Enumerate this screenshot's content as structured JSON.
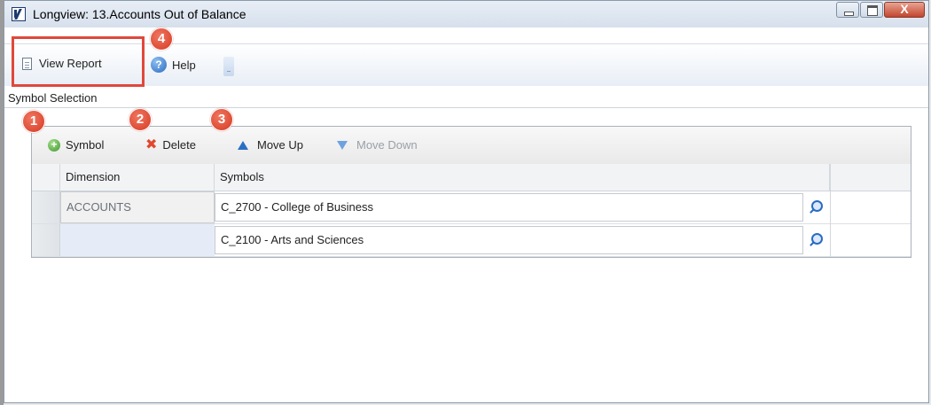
{
  "window": {
    "title": "Longview: 13.Accounts Out of Balance",
    "controls": {
      "minimize": "–",
      "maximize": "□",
      "close": "X"
    }
  },
  "toolbar": {
    "view_report_label": "View Report",
    "help_label": "Help"
  },
  "section": {
    "label": "Symbol Selection"
  },
  "grid_toolbar": {
    "symbol_label": "Symbol",
    "delete_label": "Delete",
    "move_up_label": "Move Up",
    "move_down_label": "Move Down"
  },
  "table": {
    "columns": [
      "Dimension",
      "Symbols"
    ],
    "rows": [
      {
        "dimension": "ACCOUNTS",
        "symbol": "C_2700 - College of Business"
      },
      {
        "dimension": "",
        "symbol": "C_2100 - Arts and Sciences"
      }
    ]
  },
  "callouts": [
    "1",
    "2",
    "3",
    "4"
  ],
  "colors": {
    "callout": "#e0483b",
    "accent_blue": "#2a6bc2",
    "highlight_border": "#e0483b"
  }
}
